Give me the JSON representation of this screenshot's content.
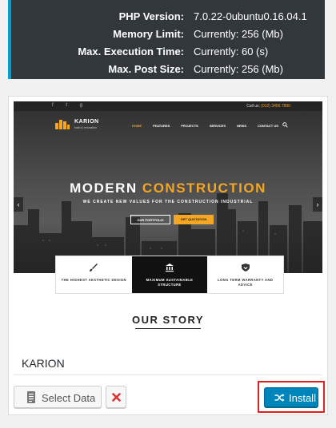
{
  "server_info": {
    "rows": [
      {
        "label": "PHP Version:",
        "value": "7.0.22-0ubuntu0.16.04.1"
      },
      {
        "label": "Memory Limit:",
        "value": "Currently: 256 (Mb)"
      },
      {
        "label": "Max. Execution Time:",
        "value": "Currently: 60 (s)"
      },
      {
        "label": "Max. Post Size:",
        "value": "Currently: 256 (Mb)"
      }
    ]
  },
  "demo": {
    "name": "KARION",
    "preview": {
      "phone_label": "Call us:",
      "phone": "(012) 3456 7890",
      "logo_text": "KARION",
      "logo_sub": "build & renovation",
      "nav": [
        "HOME",
        "FEATURES",
        "PROJECTS",
        "SERVICES",
        "NEWS",
        "CONTACT US"
      ],
      "hero_title_a": "MODERN",
      "hero_title_b": "CONSTRUCTION",
      "hero_subtitle": "WE CREATE NEW VALUES FOR THE CONSTRUCTION INDUSTRIAL",
      "btn_portfolio": "OUR PORTFOLIO",
      "btn_quotation": "GET QUOTATION",
      "features": [
        "THE HIGHEST AESTHETIC DESIGN",
        "MAXIMUM SUSTAINABLE STRUCTURE",
        "LONG TERM WARRANTY AND ADVICE"
      ],
      "story_title": "OUR STORY"
    }
  },
  "actions": {
    "select_data": "Select Data",
    "install": "Install"
  },
  "colors": {
    "accent": "#f5a623",
    "install_button": "#0085ba",
    "highlight_frame": "#e0201b",
    "delete_icon": "#dc3232",
    "info_bar": "#00a0d2"
  },
  "icons": [
    "document-icon",
    "close-icon",
    "shuffle-icon",
    "search-icon",
    "paintbrush-icon",
    "bank-icon",
    "shield-icon"
  ]
}
